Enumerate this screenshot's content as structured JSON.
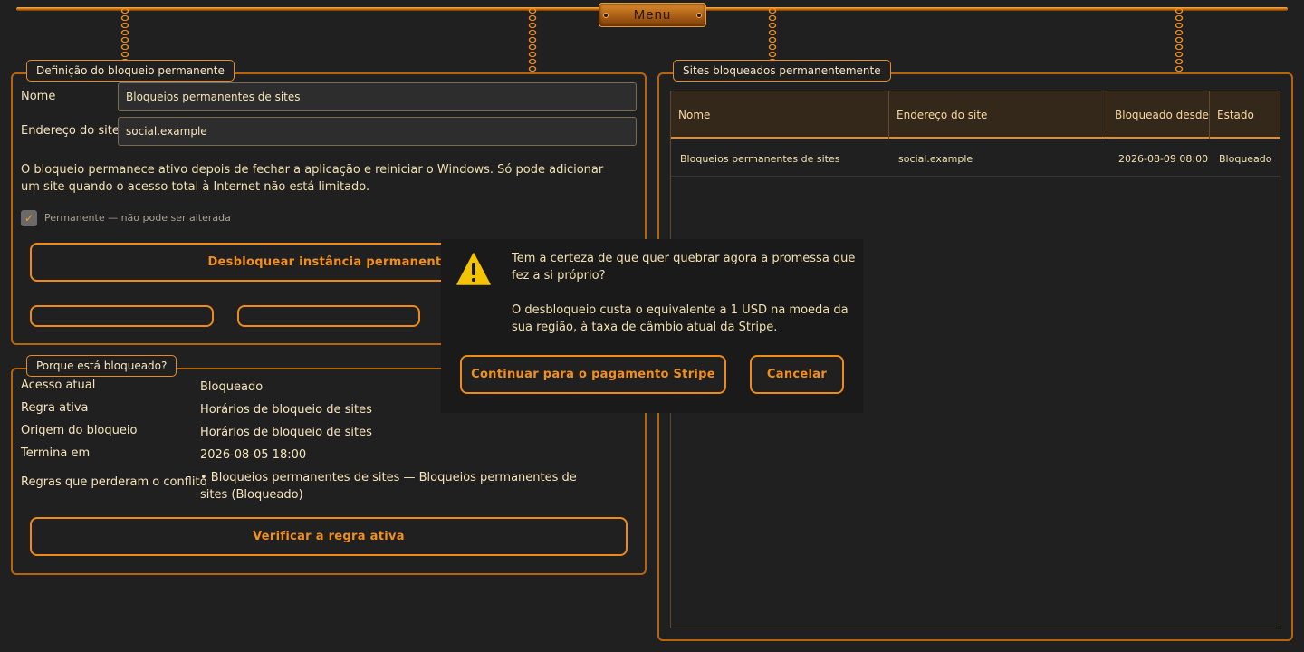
{
  "menu": {
    "label": "Menu"
  },
  "definition": {
    "legend": "Definição do bloqueio permanente",
    "name_label": "Nome",
    "name_value": "Bloqueios permanentes de sites",
    "site_label": "Endereço do site",
    "site_value": "social.example",
    "description": "O bloqueio permanece ativo depois de fechar a aplicação e reiniciar o Windows. Só pode adicionar um site quando o acesso total à Internet não está limitado.",
    "permanent_checkbox_label": "Permanente — não pode ser alterada",
    "unlock_button": "Desbloquear instância permanente"
  },
  "reason": {
    "legend": "Porque está bloqueado?",
    "rows": [
      {
        "key": "Acesso atual",
        "value": "Bloqueado"
      },
      {
        "key": "Regra ativa",
        "value": "Horários de bloqueio de sites"
      },
      {
        "key": "Origem do bloqueio",
        "value": "Horários de bloqueio de sites"
      },
      {
        "key": "Termina em",
        "value": "2026-08-05 18:00"
      },
      {
        "key": "Regras que perderam o conflito",
        "value": "• Bloqueios permanentes de sites — Bloqueios permanentes de sites (Bloqueado)"
      }
    ],
    "verify_button": "Verificar a regra ativa"
  },
  "sites": {
    "legend": "Sites bloqueados permanentemente",
    "columns": [
      "Nome",
      "Endereço do site",
      "Bloqueado desde",
      "Estado"
    ],
    "rows": [
      [
        "Bloqueios permanentes de sites",
        "social.example",
        "2026-08-09 08:00",
        "Bloqueado"
      ]
    ]
  },
  "dialog": {
    "question": "Tem a certeza de que quer quebrar agora a promessa que fez a si próprio?",
    "cost_note": "O desbloqueio custa o equivalente a 1 USD na moeda da sua região, à taxa de câmbio atual da Stripe.",
    "continue_button": "Continuar para o pagamento Stripe",
    "cancel_button": "Cancelar",
    "icon": "warning-icon"
  },
  "colors": {
    "accent": "#f08a16",
    "background": "#202020",
    "text": "#f2e0b0",
    "warning": "#f5c400"
  }
}
